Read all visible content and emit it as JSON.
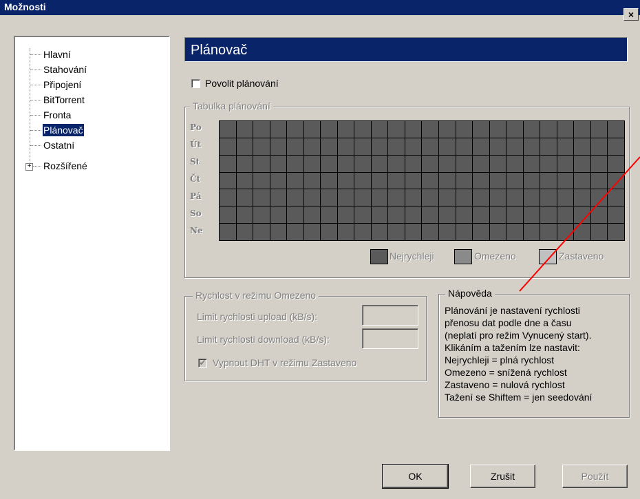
{
  "window": {
    "title": "Možnosti",
    "close_glyph": "×"
  },
  "tree": {
    "items": [
      {
        "label": "Hlavní"
      },
      {
        "label": "Stahování"
      },
      {
        "label": "Připojení"
      },
      {
        "label": "BitTorrent"
      },
      {
        "label": "Fronta"
      },
      {
        "label": "Plánovač",
        "selected": true
      },
      {
        "label": "Ostatní"
      },
      {
        "label": "Rozšířené",
        "expandable": true
      }
    ],
    "expand_glyph": "+"
  },
  "page": {
    "title": "Plánovač"
  },
  "enable_scheduler": {
    "label": "Povolit plánování",
    "checked": false
  },
  "schedule_table": {
    "title": "Tabulka plánování",
    "days": [
      "Po",
      "Út",
      "St",
      "Čt",
      "Pá",
      "So",
      "Ne"
    ],
    "hours": 24,
    "legend": [
      {
        "label": "Nejrychleji",
        "color": "#5a5a5a"
      },
      {
        "label": "Omezeno",
        "color": "#8a8a8a"
      },
      {
        "label": "Zastaveno",
        "color": "#c0c0c0"
      }
    ]
  },
  "limited_speed": {
    "title": "Rychlost v režimu Omezeno",
    "upload_label": "Limit rychlosti upload (kB/s):",
    "upload_value": "",
    "download_label": "Limit rychlosti download (kB/s):",
    "download_value": "",
    "dht_label": "Vypnout DHT v režimu Zastaveno",
    "dht_checked": true
  },
  "help": {
    "title": "Nápověda",
    "lines": [
      "Plánování je nastavení rychlosti",
      "přenosu dat podle dne a času",
      "(neplatí pro režim Vynucený start).",
      "Klikáním a tažením lze nastavit:",
      "Nejrychleji = plná rychlost",
      "Omezeno = snížená rychlost",
      "Zastaveno = nulová rychlost",
      "Tažení se Shiftem = jen seedování"
    ]
  },
  "buttons": {
    "ok": "OK",
    "cancel": "Zrušit",
    "apply": "Použít"
  },
  "colors": {
    "titlebar": "#0a246a",
    "annotation_line": "#ff0000"
  }
}
